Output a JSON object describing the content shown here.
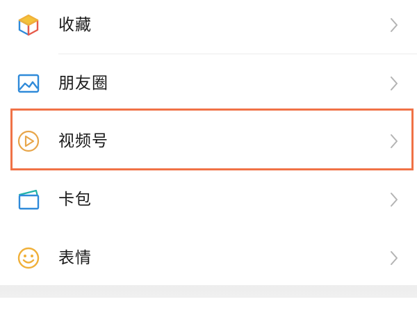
{
  "menu": {
    "items": [
      {
        "label": "收藏",
        "icon": "favorites-cube-icon"
      },
      {
        "label": "朋友圈",
        "icon": "moments-image-icon"
      },
      {
        "label": "视频号",
        "icon": "channels-play-icon"
      },
      {
        "label": "卡包",
        "icon": "card-wallet-icon"
      },
      {
        "label": "表情",
        "icon": "sticker-smiley-icon"
      }
    ],
    "highlighted_item": "视频号"
  },
  "colors": {
    "highlight_border": "#f07246",
    "label_text": "#1a1a1a",
    "chevron": "#b3b3b3",
    "divider": "#ececec",
    "channels_icon": "#e8a64a",
    "moments_icon": "#2f8ad9",
    "card_icon_teal": "#21b3a8",
    "card_icon_blue": "#2f8ad9",
    "sticker_icon": "#f0b03a"
  }
}
